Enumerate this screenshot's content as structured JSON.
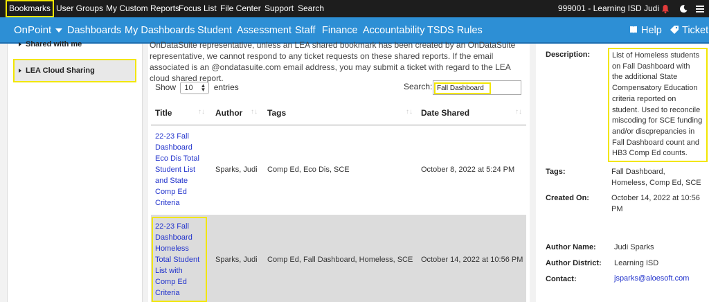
{
  "topbar": {
    "items": [
      "Bookmarks",
      "User Groups",
      "My Custom Reports",
      "Focus List",
      "File Center",
      "Support",
      "Search"
    ],
    "user_info": "999001 - Learning ISD Judi"
  },
  "navbar": {
    "brand": "OnPoint",
    "items": [
      "Dashboards",
      "My Dashboards",
      "Student",
      "Assessment",
      "Staff",
      "Finance",
      "Accountability",
      "TSDS Rules"
    ],
    "help": "Help",
    "ticket": "Ticket"
  },
  "sidebar": {
    "shared_with_me": "Shared with me",
    "lea": "LEA Cloud Sharing"
  },
  "notice": "OnDataSuite representative, unless an LEA shared bookmark has been created by an OnDataSuite representative, we cannot respond to any ticket requests on these shared reports. If the email associated is an @ondatasuite.com email address, you may submit a ticket with regard to the LEA cloud shared report.",
  "table_controls": {
    "show_label": "Show",
    "entries_value": "10",
    "entries_label": "entries",
    "search_label": "Search:",
    "search_value": "Fall Dashboard"
  },
  "table": {
    "headers": [
      "Title",
      "Author",
      "Tags",
      "Date Shared"
    ],
    "rows": [
      {
        "title_lines": [
          "22-23 Fall",
          "Dashboard",
          "Eco Dis Total",
          "Student List",
          "and State",
          "Comp Ed",
          "Criteria"
        ],
        "author": "Sparks, Judi",
        "tags": "Comp Ed, Eco Dis, SCE",
        "date": "October 8, 2022 at 5:24 PM"
      },
      {
        "title_lines": [
          "22-23 Fall",
          "Dashboard",
          "Homeless",
          "Total Student",
          "List with",
          "Comp Ed",
          "Criteria"
        ],
        "author": "Sparks, Judi",
        "tags": "Comp Ed, Fall Dashboard, Homeless, SCE",
        "date": "October 14, 2022 at 10:56 PM"
      }
    ]
  },
  "details": {
    "description_label": "Description:",
    "description_lines": [
      "List of Homeless students",
      "on Fall Dashboard with",
      "the additional State",
      "Compensatory Education",
      "criteria reported on",
      "student. Used to reconcile",
      "miscoding for SCE funding",
      "and/or discprepancies in",
      "Fall Dashboard count and",
      "HB3 Comp Ed counts."
    ],
    "tags_label": "Tags:",
    "tags_lines": [
      "Fall Dashboard,",
      "Homeless, Comp Ed, SCE"
    ],
    "created_label": "Created On:",
    "created_lines": [
      "October 14, 2022 at 10:56",
      "PM"
    ],
    "author_name_label": "Author Name:",
    "author_name": "Judi Sparks",
    "author_district_label": "Author District:",
    "author_district": "Learning ISD",
    "contact_label": "Contact:",
    "contact": "jsparks@aloesoft.com"
  },
  "colors": {
    "topbar_bg": "#1d1d1d",
    "navbar_bg": "#2d8fd5",
    "highlight": "#f2e600",
    "link": "#2233cc",
    "notification": "#e23b3b"
  }
}
